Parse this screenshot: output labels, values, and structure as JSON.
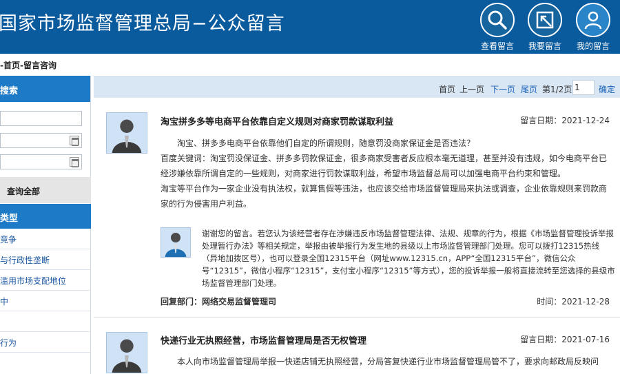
{
  "header": {
    "title": "国家市场监督管理总局−公众留言",
    "buttons": [
      {
        "label": "查看留言",
        "icon": "search-icon"
      },
      {
        "label": "我要留言",
        "icon": "write-icon"
      },
      {
        "label": "我的留言",
        "icon": "user-icon"
      }
    ]
  },
  "breadcrumb": "-首页-留言咨询",
  "sidebar": {
    "search_title": "搜索",
    "search_all": "查询全部",
    "type_title": "类型",
    "types": [
      "竞争",
      "与行政性垄断",
      "滥用市场支配地位",
      "中",
      "",
      "行为"
    ]
  },
  "pager": {
    "first": "首页",
    "prev": "上一页",
    "next": "下一页",
    "last": "尾页",
    "page_info": "第1/2页",
    "page_value": "1",
    "confirm": "确定"
  },
  "messages": [
    {
      "title": "淘宝拼多多等电商平台依靠自定义规则对商家罚款谋取利益",
      "date_label": "留言日期：",
      "date": "2021-12-24",
      "paragraphs": [
        "淘宝、拼多多电商平台依靠他们自定的所谓规则，随意罚没商家保证金是否违法？",
        "百度关键词：淘宝罚没保证金、拼多多罚款保证金，很多商家受害者反应根本毫无道理，甚至并没有违规，如今电商平台已经涉嫌依靠所谓自定的一些规则，对商家进行罚款谋取利益，希望市场监督总局可以加强电商平台约束和管理。",
        "淘宝等平台作为一家企业没有执法权，就算售假等违法，也应该交给市场监督管理局来执法或调查，企业依靠规则来罚款商家的行为侵害用户利益。"
      ],
      "reply": "谢谢您的留言。若您认为该经营者存在涉嫌违反市场监督管理法律、法规、规章的行为，根据《市场监督管理投诉举报处理暂行办法》等相关规定，举报由被举报行为发生地的县级以上市场监督管理部门处理。您可以拨打12315热线（异地加拨区号），也可以登录全国12315平台（网址www.12315.cn，APP“全国12315平台”，微信公众号“12315”，微信小程序“12315”，支付宝小程序“12315”等方式），您的投诉举报一般将直接流转至您选择的县级市场监督管理部门处理。",
      "reply_dept": "回复部门：网络交易监督管理司",
      "reply_time": "时间：2021-12-28"
    },
    {
      "title": "快递行业无执照经营，市场监督管理局是否无权管理",
      "date_label": "留言日期：",
      "date": "2021-07-16",
      "paragraphs": [
        "本人向市场监督管理局举报一快递店铺无执照经营，分局答复快递行业市场监督管理局管不了，要求向邮政局反映问"
      ]
    }
  ]
}
